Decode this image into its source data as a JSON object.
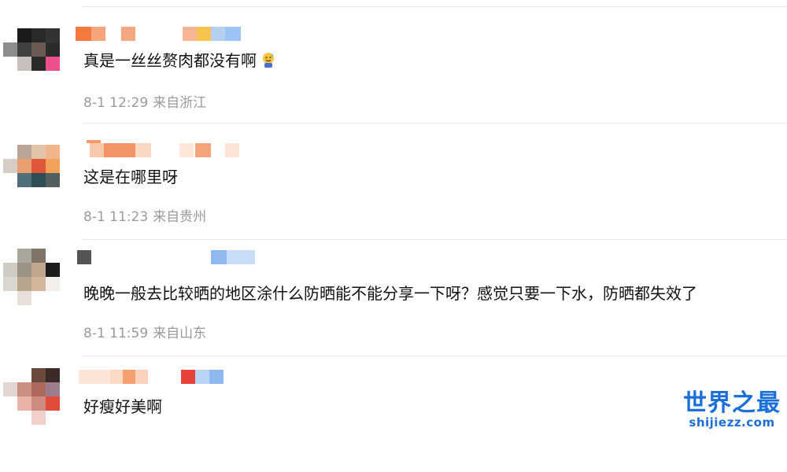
{
  "comments": [
    {
      "text": "真是一丝丝赘肉都没有啊",
      "emoji": "sweat-smile-emoji",
      "time": "8-1 12:29",
      "location": "来自浙江"
    },
    {
      "text": "这是在哪里呀",
      "time": "8-1 11:23",
      "location": "来自贵州"
    },
    {
      "text": "晚晚一般去比较晒的地区涂什么防晒能不能分享一下呀？感觉只要一下水，防晒都失效了",
      "time": "8-1 11:59",
      "location": "来自山东"
    },
    {
      "text": "好瘦好美啊"
    }
  ],
  "watermark": {
    "logo": "世界之最",
    "url": "shijiezz.com"
  },
  "colors": {
    "text": "#111111",
    "meta": "#9a9a9a",
    "divider": "#e8e8e8",
    "watermark": "#1a6fd8"
  }
}
